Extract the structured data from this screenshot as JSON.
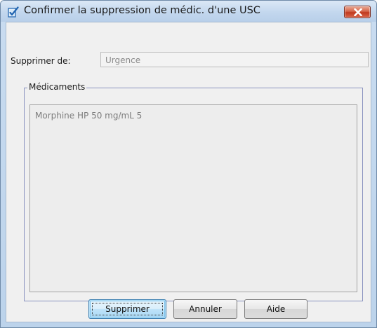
{
  "window": {
    "title": "Confirmer la suppression de médic. d'une USC"
  },
  "form": {
    "from_label": "Supprimer de:",
    "from_value": "Urgence"
  },
  "medications": {
    "group_label": "Médicaments",
    "items": [
      "Morphine HP  50 mg/mL  5"
    ]
  },
  "buttons": {
    "delete": "Supprimer",
    "cancel": "Annuler",
    "help": "Aide"
  },
  "icons": {
    "app": "checkbox-document-icon",
    "close": "close-icon"
  },
  "colors": {
    "title_bar": "#c3d7ee",
    "close_button": "#c9452a",
    "group_border": "#8a93c0",
    "primary_button": "#bfe3f9"
  }
}
